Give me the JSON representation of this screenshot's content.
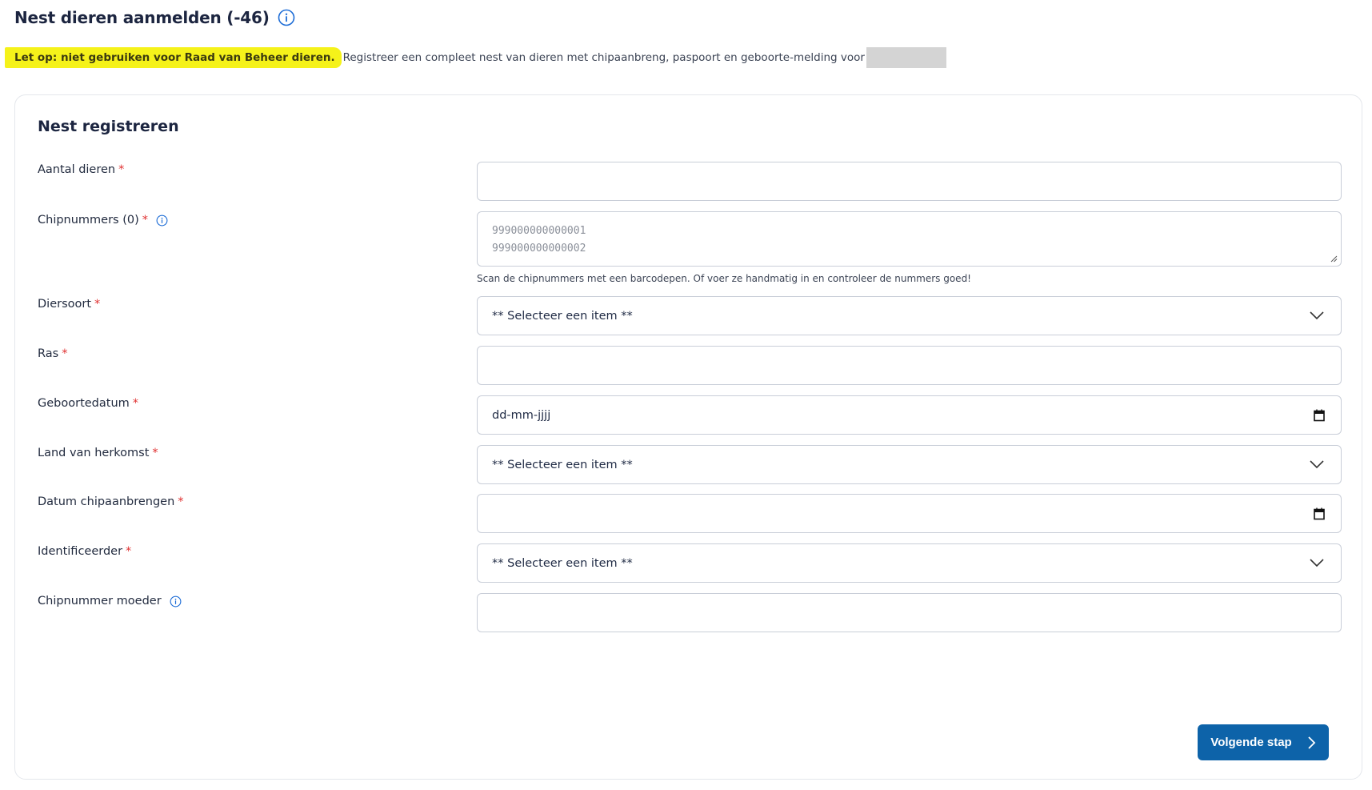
{
  "page": {
    "title": "Nest dieren aanmelden (-46)",
    "notice_highlight": "Let op: niet gebruiken voor Raad van Beheer dieren.",
    "notice_text": "Registreer een compleet nest van dieren met chipaanbreng, paspoort en geboorte-melding voor"
  },
  "card": {
    "title": "Nest registreren"
  },
  "form": {
    "aantal": {
      "label": "Aantal dieren",
      "required": "*",
      "value": ""
    },
    "chipnummers": {
      "label": "Chipnummers (0)",
      "required": "*",
      "placeholder_line1": "999000000000001",
      "placeholder_line2": "999000000000002",
      "hint": "Scan de chipnummers met een barcodepen. Of voer ze handmatig in en controleer de nummers goed!"
    },
    "diersoort": {
      "label": "Diersoort",
      "required": "*",
      "value": "** Selecteer een item **"
    },
    "ras": {
      "label": "Ras",
      "required": "*",
      "value": ""
    },
    "geboortedatum": {
      "label": "Geboortedatum",
      "required": "*",
      "value": "dd-mm-jjjj"
    },
    "land": {
      "label": "Land van herkomst",
      "required": "*",
      "value": "** Selecteer een item **"
    },
    "datum_chip": {
      "label": "Datum chipaanbrengen",
      "required": "*",
      "value": ""
    },
    "identificeerder": {
      "label": "Identificeerder",
      "required": "*",
      "value": "** Selecteer een item **"
    },
    "chip_moeder": {
      "label": "Chipnummer moeder",
      "value": ""
    }
  },
  "actions": {
    "next_label": "Volgende stap"
  },
  "colors": {
    "primary": "#0d63a9",
    "highlight": "#f5f21a",
    "required": "#e03131",
    "info": "#1c6cd6"
  }
}
